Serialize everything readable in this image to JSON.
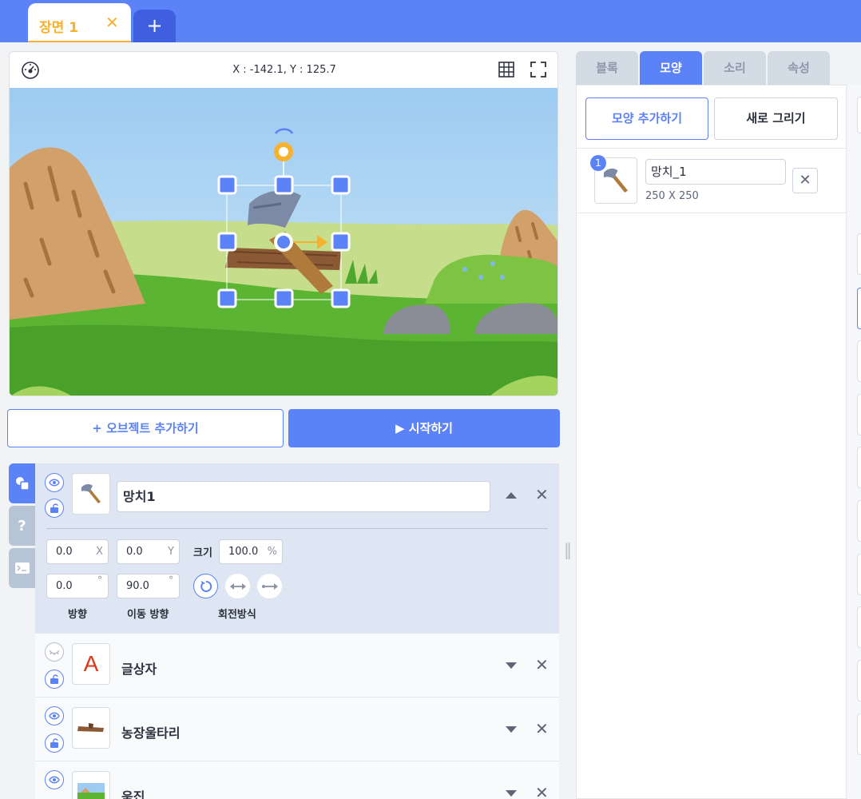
{
  "scene_tabs": {
    "current": "장면 1",
    "close": "✕",
    "add": "+"
  },
  "stage": {
    "coordinates": "X : -142.1, Y : 125.7"
  },
  "actions": {
    "add_object": "+ 오브젝트 추가하기",
    "start": "▶ 시작하기"
  },
  "objects": {
    "selected": {
      "name": "망치1",
      "x": "0.0",
      "x_suffix": "X",
      "y": "0.0",
      "y_suffix": "Y",
      "size_label": "크기",
      "size": "100.0",
      "size_unit": "%",
      "direction": "0.0",
      "direction_unit": "°",
      "move_direction": "90.0",
      "move_direction_unit": "°",
      "direction_label": "방향",
      "move_direction_label": "이동 방향",
      "rotation_label": "회전방식"
    },
    "others": [
      {
        "name": "글상자",
        "thumb_text": "A"
      },
      {
        "name": "농장울타리"
      },
      {
        "name": "움집"
      }
    ]
  },
  "right_tabs": [
    "블록",
    "모양",
    "소리",
    "속성"
  ],
  "shapes": {
    "add_button": "모양 추가하기",
    "draw_button": "새로 그리기",
    "items": [
      {
        "index": "1",
        "name": "망치_1",
        "size": "250 X 250"
      }
    ]
  },
  "colors": {
    "accent": "#5c82f7",
    "scene_tab": "#f8b12d"
  }
}
